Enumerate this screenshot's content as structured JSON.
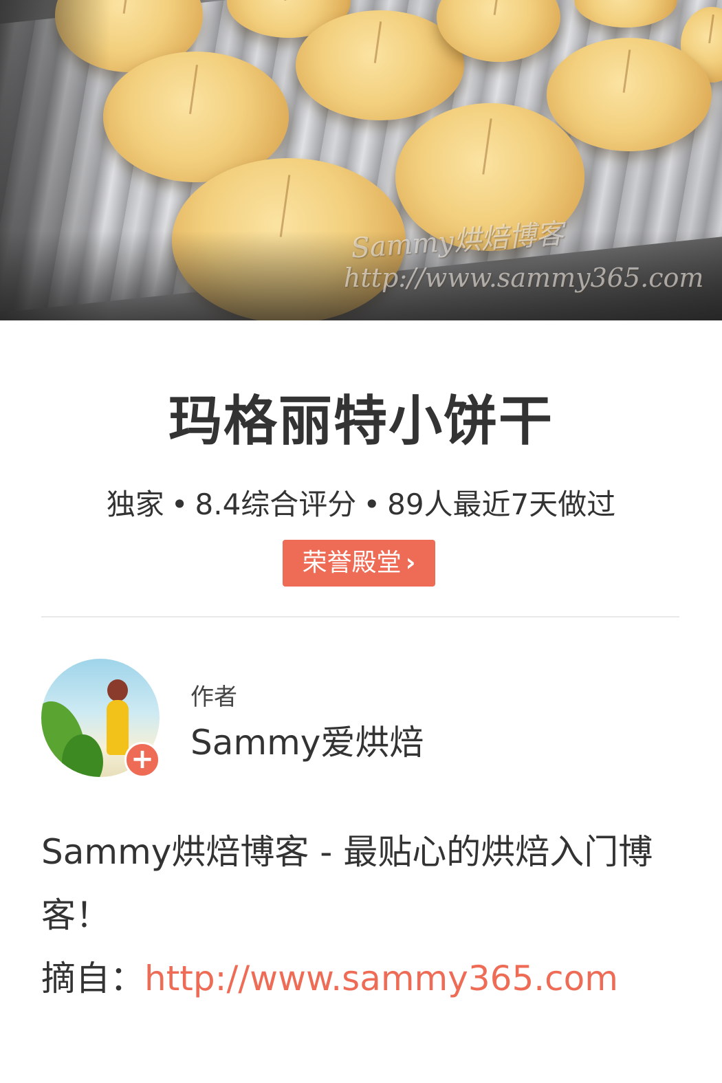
{
  "hero": {
    "watermark_line1": "Sammy烘焙博客",
    "watermark_line2": "http://www.sammy365.com"
  },
  "recipe": {
    "title": "玛格丽特小饼干",
    "stat_exclusive": "独家",
    "stat_rating": "8.4综合评分",
    "stat_cooked": "89人最近7天做过",
    "separator": "•",
    "honor_label": "荣誉殿堂",
    "honor_chevron": "›"
  },
  "author": {
    "role_label": "作者",
    "name": "Sammy爱烘焙",
    "follow_symbol": "+",
    "avatar_icon": "avatar-photo"
  },
  "description": {
    "text": "Sammy烘焙博客 - 最贴心的烘焙入门博客！",
    "source_label": "摘自：",
    "source_url": "http://www.sammy365.com"
  },
  "colors": {
    "accent": "#ee6b55",
    "text_primary": "#333333",
    "divider": "#e8e8e8"
  }
}
